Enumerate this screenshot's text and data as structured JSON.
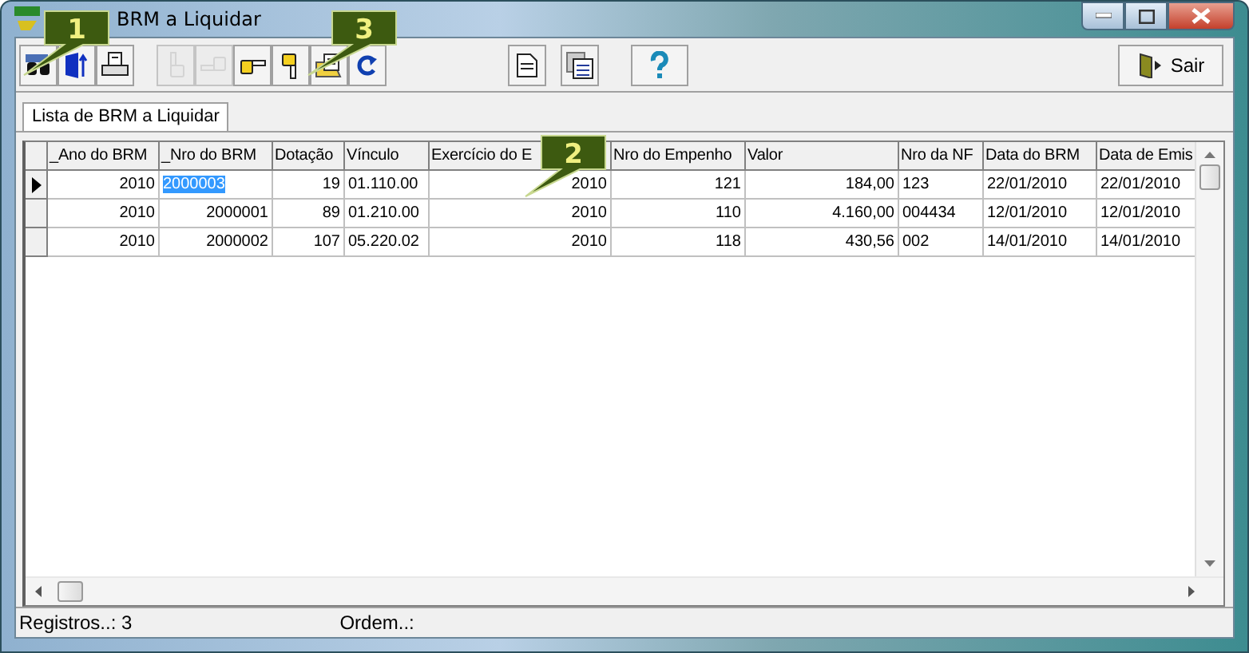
{
  "window": {
    "title": "BRM a Liquidar"
  },
  "toolbar": [
    {
      "kind": "binoculars",
      "disabled": false
    },
    {
      "kind": "export",
      "disabled": false
    },
    {
      "kind": "print",
      "disabled": false
    },
    {
      "kind": "hand-up",
      "disabled": true
    },
    {
      "kind": "hand-left",
      "disabled": true
    },
    {
      "kind": "hand-right",
      "disabled": false
    },
    {
      "kind": "hand-down",
      "disabled": false
    },
    {
      "kind": "folder-doc",
      "disabled": false
    },
    {
      "kind": "refresh",
      "disabled": false
    },
    {
      "kind": "document",
      "disabled": false
    },
    {
      "kind": "documents",
      "disabled": false
    },
    {
      "kind": "help",
      "disabled": false
    }
  ],
  "exit_button": {
    "label": "Sair"
  },
  "tabs": [
    {
      "label": "Lista de BRM a Liquidar",
      "selected": true
    }
  ],
  "table": {
    "columns": [
      {
        "label": "_Ano do BRM",
        "kind": "number"
      },
      {
        "label": "_Nro do BRM",
        "kind": "number"
      },
      {
        "label": "Dotação",
        "kind": "number"
      },
      {
        "label": "Vínculo",
        "kind": "text"
      },
      {
        "label": "Exercício do E",
        "kind": "number"
      },
      {
        "label": "Nro do Empenho",
        "kind": "number"
      },
      {
        "label": "Valor",
        "kind": "number"
      },
      {
        "label": "Nro da NF",
        "kind": "text"
      },
      {
        "label": "Data do BRM",
        "kind": "text"
      },
      {
        "label": "Data de Emis",
        "kind": "text"
      }
    ],
    "rows": [
      {
        "current": true,
        "cells": [
          {
            "text": "2010",
            "selected": false
          },
          {
            "text": "2000003",
            "selected": true
          },
          {
            "text": "19",
            "selected": false
          },
          {
            "text": "01.110.00",
            "selected": false
          },
          {
            "text": "2010",
            "selected": false
          },
          {
            "text": "121",
            "selected": false
          },
          {
            "text": "184,00",
            "selected": false
          },
          {
            "text": "123",
            "selected": false
          },
          {
            "text": "22/01/2010",
            "selected": false
          },
          {
            "text": "22/01/2010",
            "selected": false
          }
        ]
      },
      {
        "current": false,
        "cells": [
          {
            "text": "2010",
            "selected": false
          },
          {
            "text": "2000001",
            "selected": false
          },
          {
            "text": "89",
            "selected": false
          },
          {
            "text": "01.210.00",
            "selected": false
          },
          {
            "text": "2010",
            "selected": false
          },
          {
            "text": "110",
            "selected": false
          },
          {
            "text": "4.160,00",
            "selected": false
          },
          {
            "text": "004434",
            "selected": false
          },
          {
            "text": "12/01/2010",
            "selected": false
          },
          {
            "text": "12/01/2010",
            "selected": false
          }
        ]
      },
      {
        "current": false,
        "cells": [
          {
            "text": "2010",
            "selected": false
          },
          {
            "text": "2000002",
            "selected": false
          },
          {
            "text": "107",
            "selected": false
          },
          {
            "text": "05.220.02",
            "selected": false
          },
          {
            "text": "2010",
            "selected": false
          },
          {
            "text": "118",
            "selected": false
          },
          {
            "text": "430,56",
            "selected": false
          },
          {
            "text": "002",
            "selected": false
          },
          {
            "text": "14/01/2010",
            "selected": false
          },
          {
            "text": "14/01/2010",
            "selected": false
          }
        ]
      }
    ]
  },
  "status_bar": {
    "records": "Registros..: 3",
    "order": "Ordem..:"
  },
  "callouts": [
    "1",
    "2",
    "3"
  ]
}
